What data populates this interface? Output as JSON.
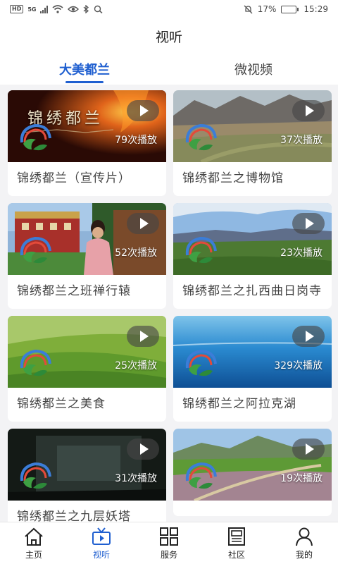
{
  "status_bar": {
    "network_badge": "HD",
    "network_type": "5G",
    "battery_percent": "17%",
    "battery_level": 0.17,
    "battery_color": "#f08a00",
    "time": "15:29"
  },
  "header": {
    "title": "视听"
  },
  "tabs": [
    {
      "label": "大美都兰",
      "active": true
    },
    {
      "label": "微视频",
      "active": false
    }
  ],
  "thumb_overlay_text": "锦绣都兰",
  "videos": [
    {
      "title": "锦绣都兰（宣传片）",
      "plays": "79次播放"
    },
    {
      "title": "锦绣都兰之博物馆",
      "plays": "37次播放"
    },
    {
      "title": "锦绣都兰之班禅行辕",
      "plays": "52次播放"
    },
    {
      "title": "锦绣都兰之扎西曲日岗寺",
      "plays": "23次播放"
    },
    {
      "title": "锦绣都兰之美食",
      "plays": "25次播放"
    },
    {
      "title": "锦绣都兰之阿拉克湖",
      "plays": "329次播放"
    },
    {
      "title": "锦绣都兰之九层妖塔",
      "plays": "31次播放"
    },
    {
      "title": "",
      "plays": "19次播放"
    }
  ],
  "bottom_nav": [
    {
      "label": "主页",
      "icon": "home-icon",
      "active": false
    },
    {
      "label": "视听",
      "icon": "video-icon",
      "active": true
    },
    {
      "label": "服务",
      "icon": "grid-icon",
      "active": false
    },
    {
      "label": "社区",
      "icon": "news-icon",
      "active": false
    },
    {
      "label": "我的",
      "icon": "user-icon",
      "active": false
    }
  ],
  "colors": {
    "accent": "#1f5fd0",
    "background": "#f3f3f5"
  }
}
